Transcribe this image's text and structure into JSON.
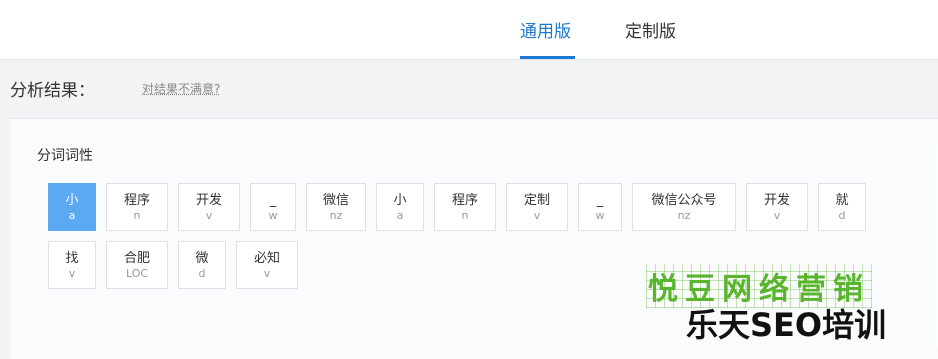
{
  "tabs": [
    {
      "label": "通用版",
      "active": true
    },
    {
      "label": "定制版",
      "active": false
    }
  ],
  "result_label": "分析结果：",
  "not_satisfied_link": "对结果不满意?",
  "panel_title": "分词词性",
  "tokens": [
    {
      "word": "小",
      "pos": "a",
      "selected": true
    },
    {
      "word": "程序",
      "pos": "n"
    },
    {
      "word": "开发",
      "pos": "v"
    },
    {
      "word": "_",
      "pos": "w"
    },
    {
      "word": "微信",
      "pos": "nz"
    },
    {
      "word": "小",
      "pos": "a"
    },
    {
      "word": "程序",
      "pos": "n"
    },
    {
      "word": "定制",
      "pos": "v"
    },
    {
      "word": "_",
      "pos": "w"
    },
    {
      "word": "微信公众号",
      "pos": "nz"
    },
    {
      "word": "开发",
      "pos": "v"
    },
    {
      "word": "就",
      "pos": "d"
    },
    {
      "word": "找",
      "pos": "v"
    },
    {
      "word": "合肥",
      "pos": "LOC"
    },
    {
      "word": "微",
      "pos": "d"
    },
    {
      "word": "必知",
      "pos": "v"
    }
  ],
  "watermark": {
    "line1": "悦豆网络营销",
    "line2": "乐天SEO培训"
  },
  "colors": {
    "accent": "#1c7bd0",
    "selected_token": "#5aa9f2",
    "watermark_green": "#58b52c"
  }
}
